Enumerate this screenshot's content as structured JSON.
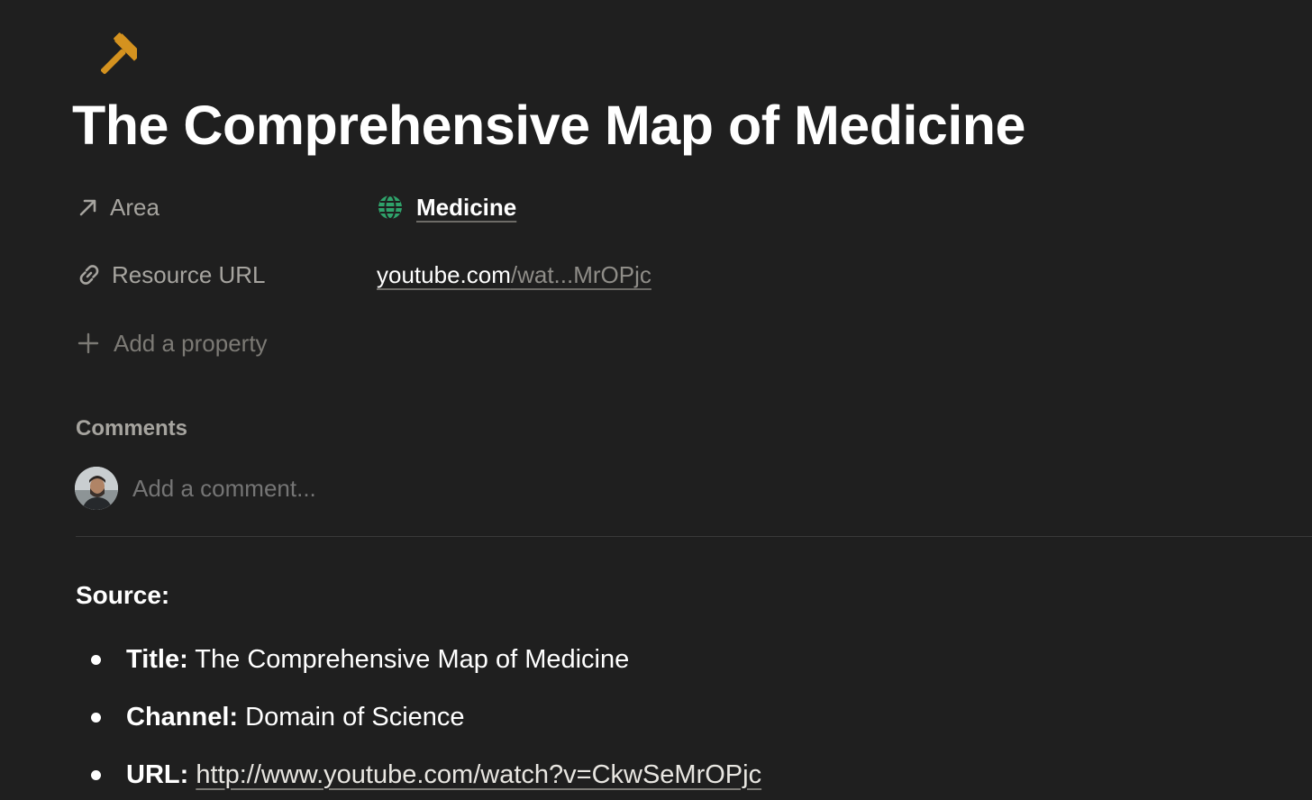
{
  "page": {
    "icon": "hammer-icon",
    "icon_color": "#d4921f",
    "title": "The Comprehensive Map of Medicine"
  },
  "properties": {
    "area": {
      "label": "Area",
      "icon": "arrow-up-right-icon",
      "value": "Medicine",
      "value_icon": "globe-icon",
      "value_icon_color": "#2fa36b"
    },
    "resource_url": {
      "label": "Resource URL",
      "icon": "link-icon",
      "value_domain": "youtube.com",
      "value_path": "/wat...MrOPjc"
    },
    "add_property": {
      "label": "Add a property",
      "icon": "plus-icon"
    }
  },
  "comments": {
    "heading": "Comments",
    "placeholder": "Add a comment..."
  },
  "content": {
    "source_heading": "Source:",
    "items": [
      {
        "label": "Title:",
        "value": "The Comprehensive Map of Medicine"
      },
      {
        "label": "Channel:",
        "value": "Domain of Science"
      },
      {
        "label": "URL:",
        "value": "http://www.youtube.com/watch?v=CkwSeMrOPjc"
      }
    ]
  }
}
